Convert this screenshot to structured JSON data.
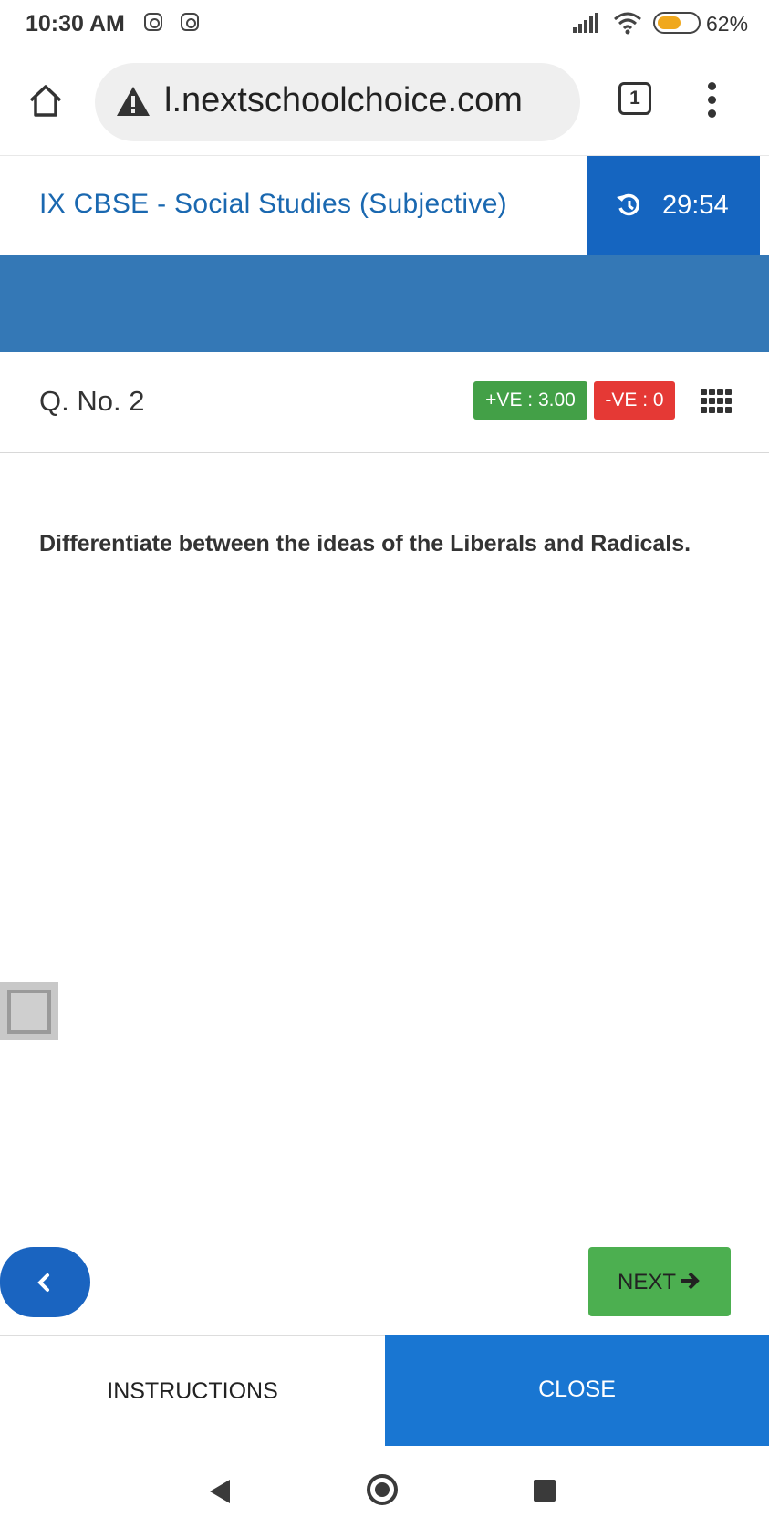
{
  "status_bar": {
    "time": "10:30 AM",
    "battery_percent": "62%",
    "battery_level": 0.62,
    "notification_icons": [
      "instagram-icon",
      "instagram-icon"
    ]
  },
  "browser": {
    "url": "l.nextschoolchoice.com",
    "tab_count": "1",
    "icons": [
      "home-icon",
      "warning-icon",
      "tabs-icon",
      "more-vert-icon"
    ]
  },
  "header": {
    "title": "IX CBSE - Social Studies (Subjective)",
    "timer": "29:54",
    "timer_icon": "history-icon"
  },
  "question": {
    "number_label": "Q. No. 2",
    "positive_marks": "+VE : 3.00",
    "negative_marks": "-VE : 0",
    "text": "Differentiate between the ideas of the Liberals and Radicals."
  },
  "navigation": {
    "next_label": "NEXT",
    "prev_icon": "chevron-left-icon",
    "next_icon": "arrow-right-icon"
  },
  "footer": {
    "instructions_label": "INSTRUCTIONS",
    "close_label": "CLOSE"
  },
  "colors": {
    "primary_blue": "#1565c0",
    "band_blue": "#3478b6",
    "title_blue": "#1a68b0",
    "positive_green": "#43a047",
    "negative_red": "#e53935",
    "next_green": "#4caf50",
    "battery_orange": "#f0a81d"
  }
}
